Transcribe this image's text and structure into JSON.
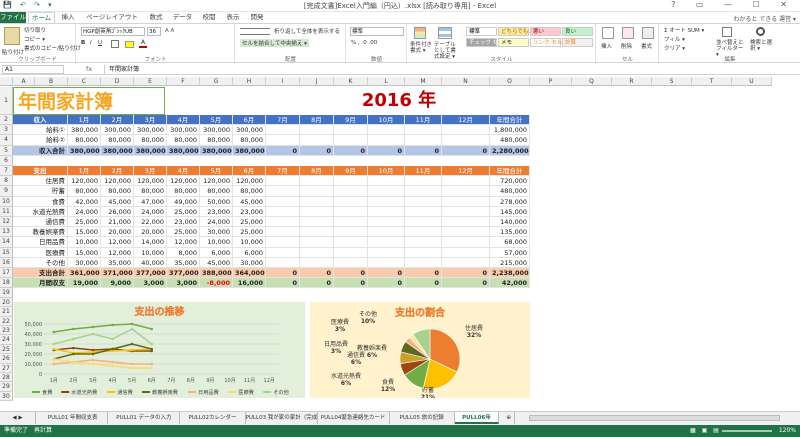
{
  "window": {
    "title": "[完成文書]Excel入門編（円込）.xlsx [読み取り専用] - Excel",
    "quick_access": "💾 ↶ ↷ ▾",
    "controls": "? ▭ — ☐ ✕"
  },
  "ribbon_tabs": [
    "ファイル",
    "ホーム",
    "挿入",
    "ページレイアウト",
    "数式",
    "データ",
    "校閲",
    "表示",
    "開発"
  ],
  "active_tab": "ホーム",
  "user": "わかると できる 運営 ▾",
  "ribbon": {
    "clipboard": {
      "label": "クリップボード",
      "paste": "貼り付け",
      "cut": "切り取り",
      "copy": "コピー ▾",
      "format_painter": "書式のコピー/貼り付け"
    },
    "font": {
      "label": "フォント",
      "font_name": "HGP創英角ｺﾞｼｯｸUB",
      "font_size": "36",
      "bold": "B",
      "italic": "I",
      "underline": "U"
    },
    "alignment": {
      "label": "配置",
      "wrap": "折り返して全体を表示する",
      "merge": "セルを結合して中央揃え ▾"
    },
    "number": {
      "label": "数値",
      "format": "標準",
      "buttons": "% , .0 .00"
    },
    "styles": {
      "label": "スタイル",
      "conditional": "条件付き書式 ▾",
      "as_table": "テーブルとして書式設定 ▾",
      "cell_styles": [
        {
          "name": "標準",
          "bg": "#ffffff",
          "fg": "#000000"
        },
        {
          "name": "どちらでも...",
          "bg": "#ffeb9c",
          "fg": "#9c6500"
        },
        {
          "name": "悪い",
          "bg": "#ffc7ce",
          "fg": "#9c0006"
        },
        {
          "name": "良い",
          "bg": "#c6efce",
          "fg": "#006100"
        },
        {
          "name": "チェック セル",
          "bg": "#a5a5a5",
          "fg": "#ffffff"
        },
        {
          "name": "メモ",
          "bg": "#ffffcc",
          "fg": "#000000"
        },
        {
          "name": "リンク セル",
          "bg": "#ffffff",
          "fg": "#fa7d00"
        },
        {
          "name": "計算",
          "bg": "#f2f2f2",
          "fg": "#fa7d00"
        }
      ]
    },
    "cells": {
      "label": "セル",
      "insert": "挿入",
      "delete": "削除",
      "format": "書式"
    },
    "editing": {
      "label": "編集",
      "autosum": "Σ オート SUM ▾",
      "fill": "フィル ▾",
      "clear": "クリア ▾",
      "sort": "並べ替えとフィルター ▾",
      "find": "検索と選択 ▾"
    }
  },
  "formula_bar": {
    "name_box": "A1",
    "fx": "fx",
    "value": "年間家計簿"
  },
  "columns": [
    "A",
    "B",
    "C",
    "D",
    "E",
    "F",
    "G",
    "H",
    "I",
    "J",
    "K",
    "L",
    "M",
    "N",
    "O",
    "P",
    "Q",
    "R",
    "S",
    "T",
    "U"
  ],
  "sheet": {
    "title": "年間家計簿",
    "year": "2016 年",
    "months": [
      "1月",
      "2月",
      "3月",
      "4月",
      "5月",
      "6月",
      "7月",
      "8月",
      "9月",
      "10月",
      "11月",
      "12月"
    ],
    "income": {
      "header": "収入",
      "total_header": "年間合計",
      "rows": [
        {
          "label": "給料①",
          "values": [
            "380,000",
            "300,000",
            "300,000",
            "300,000",
            "300,000",
            "300,000",
            "",
            "",
            "",
            "",
            "",
            ""
          ],
          "total": "1,800,000"
        },
        {
          "label": "給料②",
          "values": [
            "80,000",
            "80,000",
            "80,000",
            "80,000",
            "80,000",
            "80,000",
            "",
            "",
            "",
            "",
            "",
            ""
          ],
          "total": "480,000"
        }
      ],
      "sum": {
        "label": "収入合計",
        "values": [
          "380,000",
          "380,000",
          "380,000",
          "380,000",
          "380,000",
          "380,000",
          "0",
          "0",
          "0",
          "0",
          "0",
          "0"
        ],
        "total": "2,280,000"
      }
    },
    "expense": {
      "header": "支出",
      "total_header": "年間合計",
      "rows": [
        {
          "label": "住居費",
          "values": [
            "120,000",
            "120,000",
            "120,000",
            "120,000",
            "120,000",
            "120,000",
            "",
            "",
            "",
            "",
            "",
            ""
          ],
          "total": "720,000"
        },
        {
          "label": "貯蓄",
          "values": [
            "80,000",
            "80,000",
            "80,000",
            "80,000",
            "80,000",
            "80,000",
            "",
            "",
            "",
            "",
            "",
            ""
          ],
          "total": "480,000"
        },
        {
          "label": "食費",
          "values": [
            "42,000",
            "45,000",
            "47,000",
            "49,000",
            "50,000",
            "45,000",
            "",
            "",
            "",
            "",
            "",
            ""
          ],
          "total": "278,000"
        },
        {
          "label": "水道光熱費",
          "values": [
            "24,000",
            "26,000",
            "24,000",
            "25,000",
            "23,000",
            "23,000",
            "",
            "",
            "",
            "",
            "",
            ""
          ],
          "total": "145,000"
        },
        {
          "label": "通信費",
          "values": [
            "25,000",
            "21,000",
            "22,000",
            "23,000",
            "24,000",
            "25,000",
            "",
            "",
            "",
            "",
            "",
            ""
          ],
          "total": "140,000"
        },
        {
          "label": "教養娯楽費",
          "values": [
            "15,000",
            "20,000",
            "20,000",
            "25,000",
            "30,000",
            "25,000",
            "",
            "",
            "",
            "",
            "",
            ""
          ],
          "total": "135,000"
        },
        {
          "label": "日用品費",
          "values": [
            "10,000",
            "12,000",
            "14,000",
            "12,000",
            "10,000",
            "10,000",
            "",
            "",
            "",
            "",
            "",
            ""
          ],
          "total": "68,000"
        },
        {
          "label": "医療費",
          "values": [
            "15,000",
            "12,000",
            "10,000",
            "8,000",
            "6,000",
            "6,000",
            "",
            "",
            "",
            "",
            "",
            ""
          ],
          "total": "57,000"
        },
        {
          "label": "その他",
          "values": [
            "30,000",
            "35,000",
            "40,000",
            "35,000",
            "45,000",
            "30,000",
            "",
            "",
            "",
            "",
            "",
            ""
          ],
          "total": "215,000"
        }
      ],
      "sum": {
        "label": "支出合計",
        "values": [
          "361,000",
          "371,000",
          "377,000",
          "377,000",
          "388,000",
          "364,000",
          "0",
          "0",
          "0",
          "0",
          "0",
          "0"
        ],
        "total": "2,238,000"
      },
      "balance": {
        "label": "月間収支",
        "values": [
          "19,000",
          "9,000",
          "3,000",
          "3,000",
          "-8,000",
          "16,000",
          "0",
          "0",
          "0",
          "0",
          "0",
          "0"
        ],
        "total": "42,000"
      }
    }
  },
  "chart_data": [
    {
      "type": "line",
      "title": "支出の推移",
      "categories": [
        "1月",
        "2月",
        "3月",
        "4月",
        "5月",
        "6月",
        "7月",
        "8月",
        "9月",
        "10月",
        "11月",
        "12月"
      ],
      "ylim": [
        0,
        50000
      ],
      "yticks": [
        "50,000",
        "45,000",
        "40,000",
        "35,000",
        "30,000",
        "25,000",
        "20,000",
        "15,000",
        "10,000",
        "5,000",
        "0"
      ],
      "grid": true,
      "legend": "bottom",
      "series": [
        {
          "name": "食費",
          "color": "#70ad47",
          "values": [
            42000,
            45000,
            47000,
            49000,
            50000,
            45000
          ]
        },
        {
          "name": "水道光熱費",
          "color": "#8b4513",
          "values": [
            24000,
            26000,
            24000,
            25000,
            23000,
            23000
          ]
        },
        {
          "name": "通信費",
          "color": "#ffc000",
          "values": [
            25000,
            21000,
            22000,
            23000,
            24000,
            25000
          ]
        },
        {
          "name": "教養娯楽費",
          "color": "#5b6b1e",
          "values": [
            15000,
            20000,
            20000,
            25000,
            30000,
            25000
          ]
        },
        {
          "name": "日用品費",
          "color": "#f4b183",
          "values": [
            10000,
            12000,
            14000,
            12000,
            10000,
            10000
          ]
        },
        {
          "name": "医療費",
          "color": "#ffd966",
          "values": [
            15000,
            12000,
            10000,
            8000,
            6000,
            6000
          ]
        },
        {
          "name": "その他",
          "color": "#a9d18e",
          "values": [
            30000,
            35000,
            40000,
            35000,
            45000,
            30000
          ]
        }
      ]
    },
    {
      "type": "pie",
      "title": "支出の割合",
      "legend": "none",
      "slices": [
        {
          "name": "住居費",
          "value": 720000,
          "pct": "32%",
          "color": "#ed7d31"
        },
        {
          "name": "貯蓄",
          "value": 480000,
          "pct": "21%",
          "color": "#ffc000"
        },
        {
          "name": "食費",
          "value": 278000,
          "pct": "12%",
          "color": "#70ad47"
        },
        {
          "name": "水道光熱費",
          "value": 145000,
          "pct": "6%",
          "color": "#9e480e"
        },
        {
          "name": "通信費",
          "value": 140000,
          "pct": "6%",
          "color": "#c9a227"
        },
        {
          "name": "教養娯楽費",
          "value": 135000,
          "pct": "6%",
          "color": "#5b6b1e"
        },
        {
          "name": "日用品費",
          "value": 68000,
          "pct": "3%",
          "color": "#f4b183"
        },
        {
          "name": "医療費",
          "value": 57000,
          "pct": "3%",
          "color": "#ffe699"
        },
        {
          "name": "その他",
          "value": 215000,
          "pct": "10%",
          "color": "#a9d18e"
        }
      ]
    }
  ],
  "sheet_tabs": [
    "PULL01 年間収支表",
    "PULL01 データの入力",
    "PULL02カレンダー",
    "PULL03 我が家の家計（完成）",
    "PULL04緊急連絡先カード",
    "PULL05 旅の記録",
    "PULL06年"
  ],
  "active_sheet": "PULL06年",
  "status": {
    "left": "準備完了　再計算",
    "zoom": "120%"
  }
}
